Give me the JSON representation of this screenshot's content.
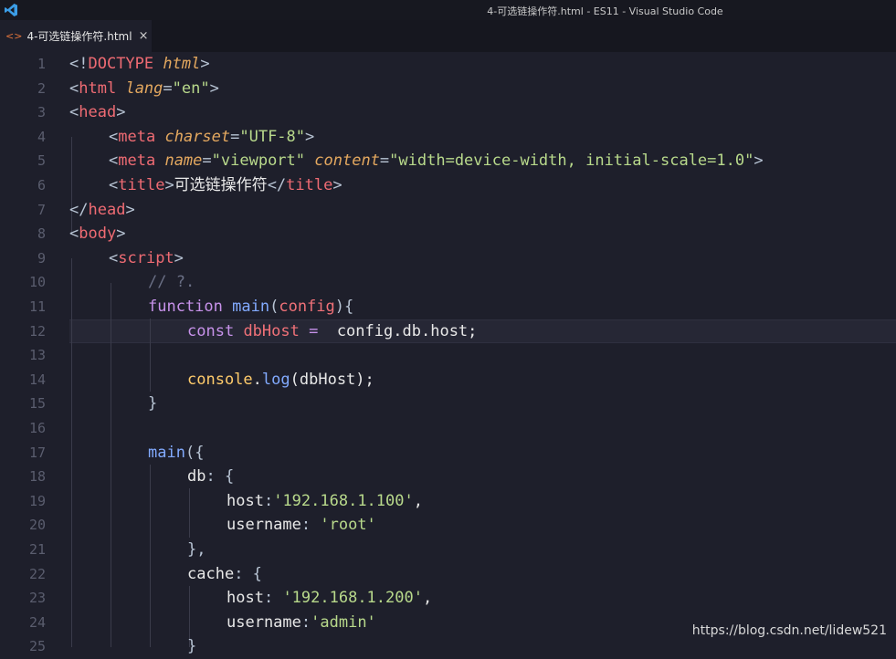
{
  "window": {
    "title": "4-可选链操作符.html - ES11 - Visual Studio Code"
  },
  "tab": {
    "label": "4-可选链操作符.html",
    "close": "×",
    "icon": "html-file-icon"
  },
  "watermark": "https://blog.csdn.net/lidew521",
  "colors": {
    "tag": "#ef6b73",
    "attr": "#e4a85f",
    "string": "#b8d98b",
    "keyword": "#c792ea",
    "function": "#82aaff",
    "comment": "#6a6f85"
  },
  "lines": [
    {
      "n": "1"
    },
    {
      "n": "2"
    },
    {
      "n": "3"
    },
    {
      "n": "4"
    },
    {
      "n": "5"
    },
    {
      "n": "6"
    },
    {
      "n": "7"
    },
    {
      "n": "8"
    },
    {
      "n": "9"
    },
    {
      "n": "10"
    },
    {
      "n": "11"
    },
    {
      "n": "12"
    },
    {
      "n": "13"
    },
    {
      "n": "14"
    },
    {
      "n": "15"
    },
    {
      "n": "16"
    },
    {
      "n": "17"
    },
    {
      "n": "18"
    },
    {
      "n": "19"
    },
    {
      "n": "20"
    },
    {
      "n": "21"
    },
    {
      "n": "22"
    },
    {
      "n": "23"
    },
    {
      "n": "24"
    },
    {
      "n": "25"
    }
  ],
  "code": {
    "l1": [
      "<!",
      "DOCTYPE",
      " ",
      "html",
      ">"
    ],
    "l2": [
      "<",
      "html",
      " ",
      "lang",
      "=",
      "\"en\"",
      ">"
    ],
    "l3": [
      "<",
      "head",
      ">"
    ],
    "l4": [
      "<",
      "meta",
      " ",
      "charset",
      "=",
      "\"UTF-8\"",
      ">"
    ],
    "l5": [
      "<",
      "meta",
      " ",
      "name",
      "=",
      "\"viewport\"",
      " ",
      "content",
      "=",
      "\"width=device-width, initial-scale=1.0\"",
      ">"
    ],
    "l6": [
      "<",
      "title",
      ">",
      "可选链操作符",
      "</",
      "title",
      ">"
    ],
    "l7": [
      "</",
      "head",
      ">"
    ],
    "l8": [
      "<",
      "body",
      ">"
    ],
    "l9": [
      "<",
      "script",
      ">"
    ],
    "l10": [
      "// ?."
    ],
    "l11": [
      "function",
      " ",
      "main",
      "(",
      "config",
      ")",
      "{"
    ],
    "l12": [
      "const",
      " ",
      "dbHost",
      " =  ",
      "config",
      ".",
      "db",
      ".",
      "host",
      ";"
    ],
    "l14": [
      "console",
      ".",
      "log",
      "(",
      "dbHost",
      ");"
    ],
    "l15": [
      "}"
    ],
    "l17": [
      "main",
      "({"
    ],
    "l18": [
      "db",
      ": {"
    ],
    "l19": [
      "host",
      ":",
      "'192.168.1.100'",
      ","
    ],
    "l20": [
      "username",
      ": ",
      "'root'"
    ],
    "l21": [
      "},"
    ],
    "l22": [
      "cache",
      ": {"
    ],
    "l23": [
      "host",
      ": ",
      "'192.168.1.200'",
      ","
    ],
    "l24": [
      "username",
      ":",
      "'admin'"
    ],
    "l25": [
      "}"
    ]
  }
}
